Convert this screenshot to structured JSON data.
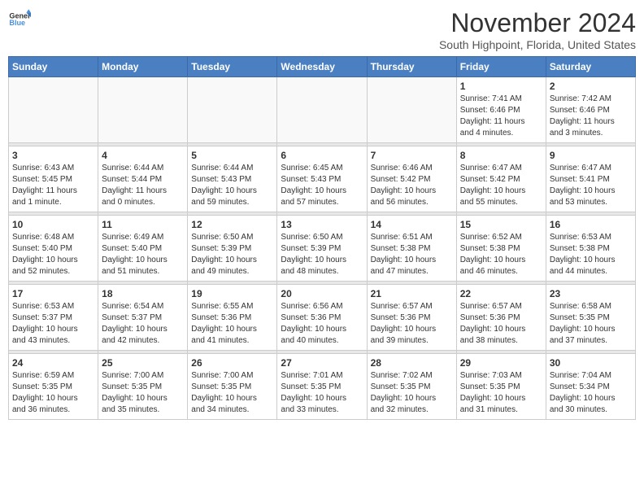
{
  "header": {
    "logo_general": "General",
    "logo_blue": "Blue",
    "month_title": "November 2024",
    "subtitle": "South Highpoint, Florida, United States"
  },
  "weekdays": [
    "Sunday",
    "Monday",
    "Tuesday",
    "Wednesday",
    "Thursday",
    "Friday",
    "Saturday"
  ],
  "weeks": [
    [
      {
        "day": "",
        "info": ""
      },
      {
        "day": "",
        "info": ""
      },
      {
        "day": "",
        "info": ""
      },
      {
        "day": "",
        "info": ""
      },
      {
        "day": "",
        "info": ""
      },
      {
        "day": "1",
        "info": "Sunrise: 7:41 AM\nSunset: 6:46 PM\nDaylight: 11 hours\nand 4 minutes."
      },
      {
        "day": "2",
        "info": "Sunrise: 7:42 AM\nSunset: 6:46 PM\nDaylight: 11 hours\nand 3 minutes."
      }
    ],
    [
      {
        "day": "3",
        "info": "Sunrise: 6:43 AM\nSunset: 5:45 PM\nDaylight: 11 hours\nand 1 minute."
      },
      {
        "day": "4",
        "info": "Sunrise: 6:44 AM\nSunset: 5:44 PM\nDaylight: 11 hours\nand 0 minutes."
      },
      {
        "day": "5",
        "info": "Sunrise: 6:44 AM\nSunset: 5:43 PM\nDaylight: 10 hours\nand 59 minutes."
      },
      {
        "day": "6",
        "info": "Sunrise: 6:45 AM\nSunset: 5:43 PM\nDaylight: 10 hours\nand 57 minutes."
      },
      {
        "day": "7",
        "info": "Sunrise: 6:46 AM\nSunset: 5:42 PM\nDaylight: 10 hours\nand 56 minutes."
      },
      {
        "day": "8",
        "info": "Sunrise: 6:47 AM\nSunset: 5:42 PM\nDaylight: 10 hours\nand 55 minutes."
      },
      {
        "day": "9",
        "info": "Sunrise: 6:47 AM\nSunset: 5:41 PM\nDaylight: 10 hours\nand 53 minutes."
      }
    ],
    [
      {
        "day": "10",
        "info": "Sunrise: 6:48 AM\nSunset: 5:40 PM\nDaylight: 10 hours\nand 52 minutes."
      },
      {
        "day": "11",
        "info": "Sunrise: 6:49 AM\nSunset: 5:40 PM\nDaylight: 10 hours\nand 51 minutes."
      },
      {
        "day": "12",
        "info": "Sunrise: 6:50 AM\nSunset: 5:39 PM\nDaylight: 10 hours\nand 49 minutes."
      },
      {
        "day": "13",
        "info": "Sunrise: 6:50 AM\nSunset: 5:39 PM\nDaylight: 10 hours\nand 48 minutes."
      },
      {
        "day": "14",
        "info": "Sunrise: 6:51 AM\nSunset: 5:38 PM\nDaylight: 10 hours\nand 47 minutes."
      },
      {
        "day": "15",
        "info": "Sunrise: 6:52 AM\nSunset: 5:38 PM\nDaylight: 10 hours\nand 46 minutes."
      },
      {
        "day": "16",
        "info": "Sunrise: 6:53 AM\nSunset: 5:38 PM\nDaylight: 10 hours\nand 44 minutes."
      }
    ],
    [
      {
        "day": "17",
        "info": "Sunrise: 6:53 AM\nSunset: 5:37 PM\nDaylight: 10 hours\nand 43 minutes."
      },
      {
        "day": "18",
        "info": "Sunrise: 6:54 AM\nSunset: 5:37 PM\nDaylight: 10 hours\nand 42 minutes."
      },
      {
        "day": "19",
        "info": "Sunrise: 6:55 AM\nSunset: 5:36 PM\nDaylight: 10 hours\nand 41 minutes."
      },
      {
        "day": "20",
        "info": "Sunrise: 6:56 AM\nSunset: 5:36 PM\nDaylight: 10 hours\nand 40 minutes."
      },
      {
        "day": "21",
        "info": "Sunrise: 6:57 AM\nSunset: 5:36 PM\nDaylight: 10 hours\nand 39 minutes."
      },
      {
        "day": "22",
        "info": "Sunrise: 6:57 AM\nSunset: 5:36 PM\nDaylight: 10 hours\nand 38 minutes."
      },
      {
        "day": "23",
        "info": "Sunrise: 6:58 AM\nSunset: 5:35 PM\nDaylight: 10 hours\nand 37 minutes."
      }
    ],
    [
      {
        "day": "24",
        "info": "Sunrise: 6:59 AM\nSunset: 5:35 PM\nDaylight: 10 hours\nand 36 minutes."
      },
      {
        "day": "25",
        "info": "Sunrise: 7:00 AM\nSunset: 5:35 PM\nDaylight: 10 hours\nand 35 minutes."
      },
      {
        "day": "26",
        "info": "Sunrise: 7:00 AM\nSunset: 5:35 PM\nDaylight: 10 hours\nand 34 minutes."
      },
      {
        "day": "27",
        "info": "Sunrise: 7:01 AM\nSunset: 5:35 PM\nDaylight: 10 hours\nand 33 minutes."
      },
      {
        "day": "28",
        "info": "Sunrise: 7:02 AM\nSunset: 5:35 PM\nDaylight: 10 hours\nand 32 minutes."
      },
      {
        "day": "29",
        "info": "Sunrise: 7:03 AM\nSunset: 5:35 PM\nDaylight: 10 hours\nand 31 minutes."
      },
      {
        "day": "30",
        "info": "Sunrise: 7:04 AM\nSunset: 5:34 PM\nDaylight: 10 hours\nand 30 minutes."
      }
    ]
  ]
}
